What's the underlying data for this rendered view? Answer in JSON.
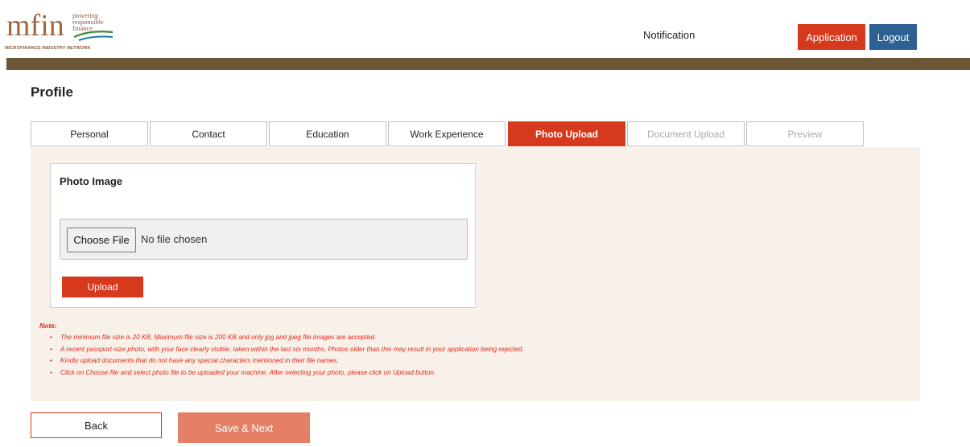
{
  "header": {
    "logo": {
      "wordmark": "mfin",
      "tagline_line1": "powering",
      "tagline_line2": "responsible",
      "tagline_line3": "finance",
      "org_name": "MICROFINANCE INDUSTRY NETWORK"
    },
    "notification_label": "Notification",
    "application_label": "Application",
    "logout_label": "Logout"
  },
  "page": {
    "title": "Profile"
  },
  "tabs": [
    {
      "label": "Personal",
      "state": "normal"
    },
    {
      "label": "Contact",
      "state": "normal"
    },
    {
      "label": "Education",
      "state": "normal"
    },
    {
      "label": "Work Experience",
      "state": "normal"
    },
    {
      "label": "Photo Upload",
      "state": "active"
    },
    {
      "label": "Document Upload",
      "state": "disabled"
    },
    {
      "label": "Preview",
      "state": "disabled"
    }
  ],
  "photo": {
    "card_title": "Photo Image",
    "choose_file_label": "Choose File",
    "file_status": "No file chosen",
    "upload_label": "Upload"
  },
  "note": {
    "title": "Note:",
    "items": [
      "The minimum file size is 20 KB, Maximum file size is 200 KB and only jpg and jpeg file images are accepted.",
      "A recent passport-size photo, with your face clearly visible, taken within the last six months, Photos older than this may result in your application being rejected.",
      "Kindly upload documents that do not have any special characters mentioned in their file names.",
      "Click on Choose file and select photo file to be uploaded your machine. After selecting your photo, please click on Upload button."
    ]
  },
  "footer": {
    "back_label": "Back",
    "save_next_label": "Save & Next"
  },
  "colors": {
    "accent_red": "#d7391c",
    "logout_blue": "#2d6093",
    "brand_bar": "#6b5636",
    "panel_bg": "#f8f1e9",
    "note_text": "#e0281c",
    "save_button_disabled": "#e48065"
  }
}
